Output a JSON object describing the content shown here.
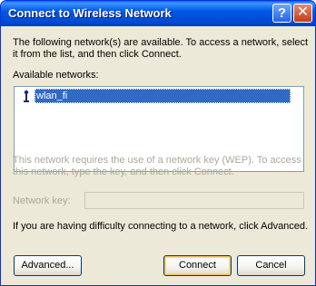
{
  "window": {
    "title": "Connect to Wireless Network",
    "help_glyph": "?",
    "close_glyph": "✕"
  },
  "content": {
    "intro_line1": "The following network(s) are available. To access a network, select",
    "intro_line2": "it from the list, and then click Connect.",
    "available_label": "Available networks:",
    "networks": [
      {
        "name": "wlan_fi",
        "selected": true,
        "icon": "wireless-antenna-icon"
      }
    ],
    "key_info_line1": "This network requires the use of a network key (WEP). To access",
    "key_info_line2": "this network, type the key, and then click Connect.",
    "network_key_label": "Network key:",
    "network_key_value": "",
    "advanced_hint": "If you are having difficulty connecting to a network, click Advanced."
  },
  "buttons": {
    "advanced": "Advanced...",
    "connect": "Connect",
    "cancel": "Cancel"
  },
  "colors": {
    "titlebar": "#0058e6",
    "dialog_bg": "#ece9d8",
    "selection": "#316ac5",
    "disabled_text": "#aca899"
  }
}
